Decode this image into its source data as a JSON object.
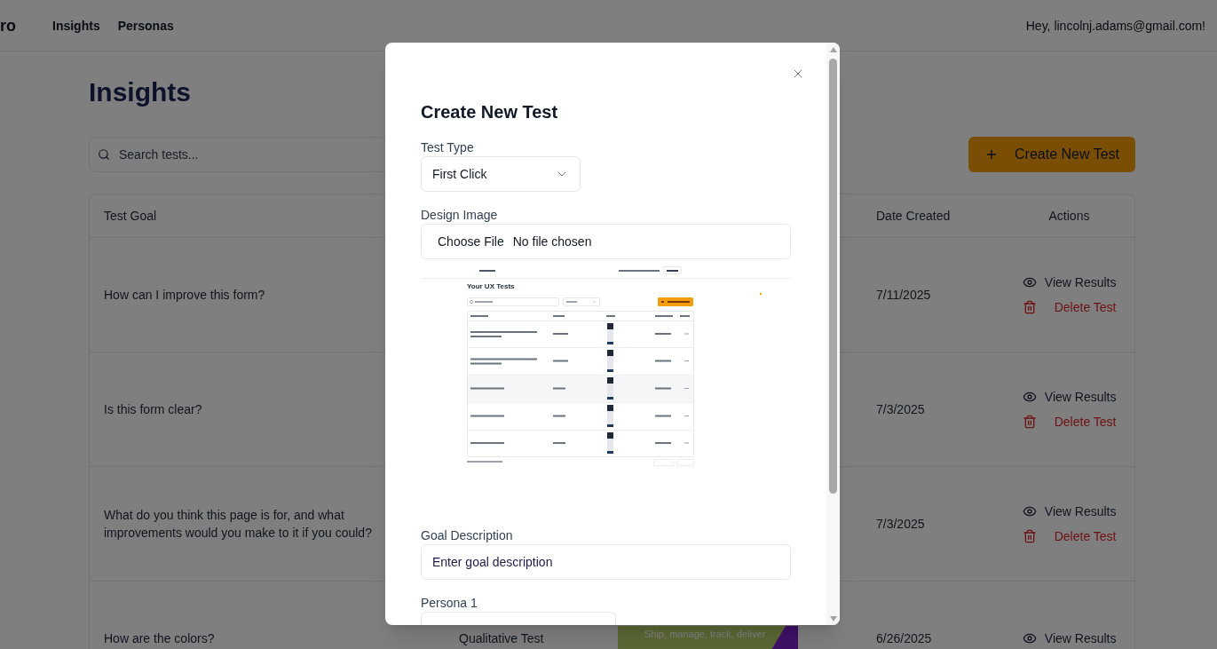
{
  "nav": {
    "logo": "ro",
    "links": [
      {
        "label": "Insights"
      },
      {
        "label": "Personas"
      }
    ],
    "greeting": "Hey, lincolnj.adams@gmail.com!"
  },
  "page": {
    "title": "Insights",
    "search": {
      "placeholder": "Search tests..."
    },
    "create_button": "Create New Test"
  },
  "table": {
    "columns": [
      "Test Goal",
      "Date Created",
      "Actions"
    ],
    "rows": [
      {
        "goal": "How can I improve this form?",
        "date_created": "7/11/2025",
        "actions": [
          {
            "kind": "view",
            "label": "View Results"
          },
          {
            "kind": "delete",
            "label": "Delete Test"
          }
        ]
      },
      {
        "goal": "Is this form clear?",
        "date_created": "7/3/2025",
        "actions": [
          {
            "kind": "view",
            "label": "View Results"
          },
          {
            "kind": "delete",
            "label": "Delete Test"
          }
        ]
      },
      {
        "goal": "What do you think this page is for, and what improvements would you make to it if you could?",
        "date_created": "7/3/2025",
        "actions": [
          {
            "kind": "view",
            "label": "View Results"
          },
          {
            "kind": "delete",
            "label": "Delete Test"
          }
        ]
      },
      {
        "goal": "How are the colors?",
        "test_type": "Qualitative Test",
        "design": {
          "caption": "Ship, manage, track, deliver"
        },
        "date_created": "6/26/2025",
        "actions": [
          {
            "kind": "view",
            "label": "View Results"
          }
        ]
      }
    ]
  },
  "modal": {
    "title": "Create New Test",
    "fields": [
      {
        "kind": "select",
        "label": "Test Type",
        "value": "First Click"
      },
      {
        "kind": "file",
        "label": "Design Image",
        "button": "Choose File",
        "status": "No file chosen",
        "preview": {
          "title": "Your UX Tests"
        }
      },
      {
        "kind": "text",
        "label": "Goal Description",
        "placeholder": "Enter goal description"
      },
      {
        "kind": "select",
        "label": "Persona 1"
      }
    ]
  }
}
